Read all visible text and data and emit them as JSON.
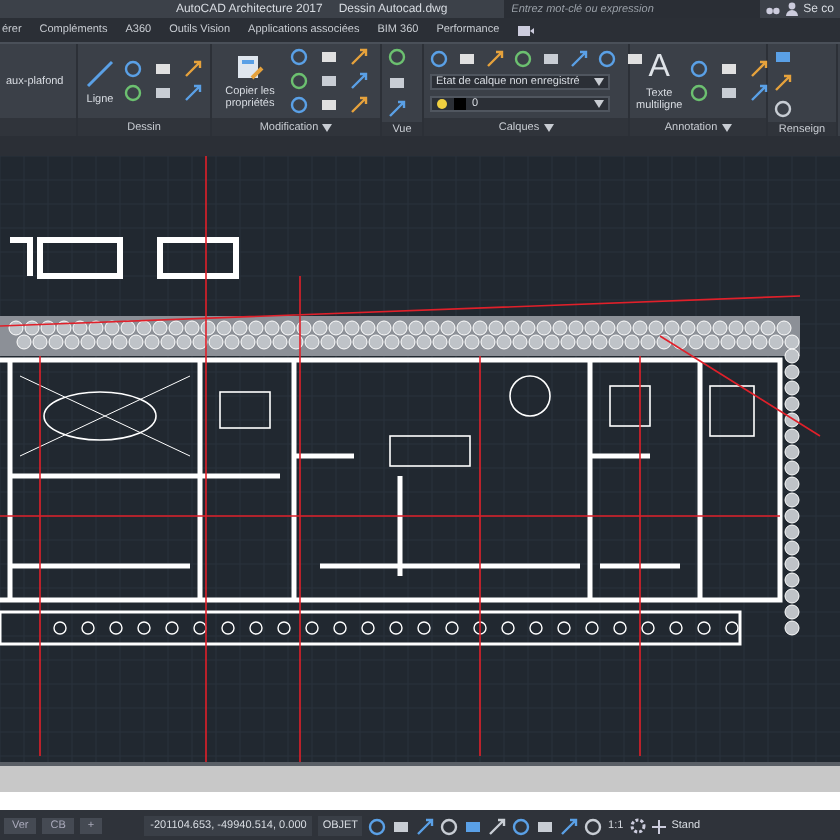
{
  "title_bar": {
    "app": "AutoCAD Architecture 2017",
    "document": "Dessin Autocad.dwg",
    "search": {
      "placeholder": "Entrez mot-clé ou expression"
    },
    "sign_in": "Se co"
  },
  "ribbon_tabs": [
    {
      "label": "érer",
      "selected": false
    },
    {
      "label": "Compléments",
      "selected": false
    },
    {
      "label": "A360",
      "selected": false
    },
    {
      "label": "Outils Vision",
      "selected": false
    },
    {
      "label": "Applications associées",
      "selected": false
    },
    {
      "label": "BIM 360",
      "selected": false
    },
    {
      "label": "Performance",
      "selected": false
    }
  ],
  "panels": [
    {
      "kind": "tool",
      "tool": "aux-plafond"
    },
    {
      "kind": "draw",
      "title": "Dessin",
      "tool": "Ligne"
    },
    {
      "kind": "modify",
      "title": "Modification",
      "menu": true,
      "tool": "Copier les propriétés"
    },
    {
      "kind": "view",
      "title": "Vue"
    },
    {
      "kind": "layers",
      "title": "Calques",
      "menu": true,
      "layer_state": "Etat de calque non enregistré",
      "layer": "0"
    },
    {
      "kind": "annotation",
      "title": "Annotation",
      "menu": true,
      "glyph": "A",
      "tool": "Texte multiligne"
    },
    {
      "kind": "cut",
      "title": "Renseign"
    }
  ],
  "status_bar": {
    "layout_tabs": [
      "Ver",
      "CB",
      "+"
    ],
    "coordinates": "-201104.653, -49940.514, 0.000",
    "mode": "OBJET",
    "scale": "1:1",
    "style": "Stand"
  }
}
